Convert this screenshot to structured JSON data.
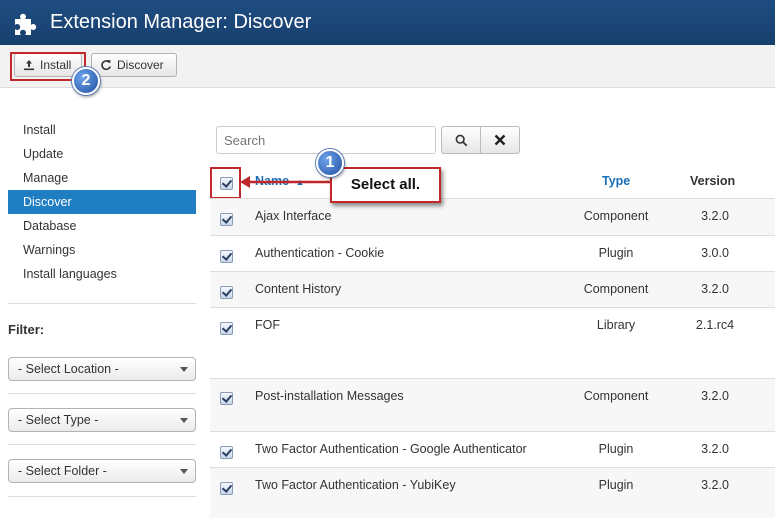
{
  "header": {
    "title": "Extension Manager: Discover",
    "icon": "puzzle-icon"
  },
  "toolbar": {
    "install_label": "Install",
    "discover_label": "Discover",
    "install_icon": "upload-icon",
    "discover_icon": "refresh-icon"
  },
  "sidebar": {
    "items": [
      {
        "label": "Install",
        "active": false
      },
      {
        "label": "Update",
        "active": false
      },
      {
        "label": "Manage",
        "active": false
      },
      {
        "label": "Discover",
        "active": true
      },
      {
        "label": "Database",
        "active": false
      },
      {
        "label": "Warnings",
        "active": false
      },
      {
        "label": "Install languages",
        "active": false
      }
    ]
  },
  "filter": {
    "title": "Filter:",
    "location": "- Select Location -",
    "type": "- Select Type -",
    "folder": "- Select Folder -"
  },
  "search": {
    "placeholder": "Search",
    "search_icon": "search-icon",
    "clear_icon": "close-icon"
  },
  "table": {
    "headers": {
      "name": "Name",
      "type": "Type",
      "version": "Version"
    },
    "sort_icon": "sort-up-icon",
    "rows": [
      {
        "name": "Ajax Interface",
        "type": "Component",
        "version": "3.2.0",
        "checked": true
      },
      {
        "name": "Authentication - Cookie",
        "type": "Plugin",
        "version": "3.0.0",
        "checked": true
      },
      {
        "name": "Content History",
        "type": "Component",
        "version": "3.2.0",
        "checked": true
      },
      {
        "name": "FOF",
        "type": "Library",
        "version": "2.1.rc4",
        "checked": true
      },
      {
        "name": "Post-installation Messages",
        "type": "Component",
        "version": "3.2.0",
        "checked": true
      },
      {
        "name": "Two Factor Authentication - Google Authenticator",
        "type": "Plugin",
        "version": "3.2.0",
        "checked": true
      },
      {
        "name": "Two Factor Authentication - YubiKey",
        "type": "Plugin",
        "version": "3.2.0",
        "checked": true
      }
    ]
  },
  "annotations": {
    "step1_number": "1",
    "step1_text": "Select all.",
    "step2_number": "2",
    "highlight_color": "#c0282b",
    "badge_color": "#1f4fa3"
  },
  "colors": {
    "header_bg": "#1f4d81",
    "active_bg": "#1f7dc2",
    "link": "#1a6fb5"
  }
}
